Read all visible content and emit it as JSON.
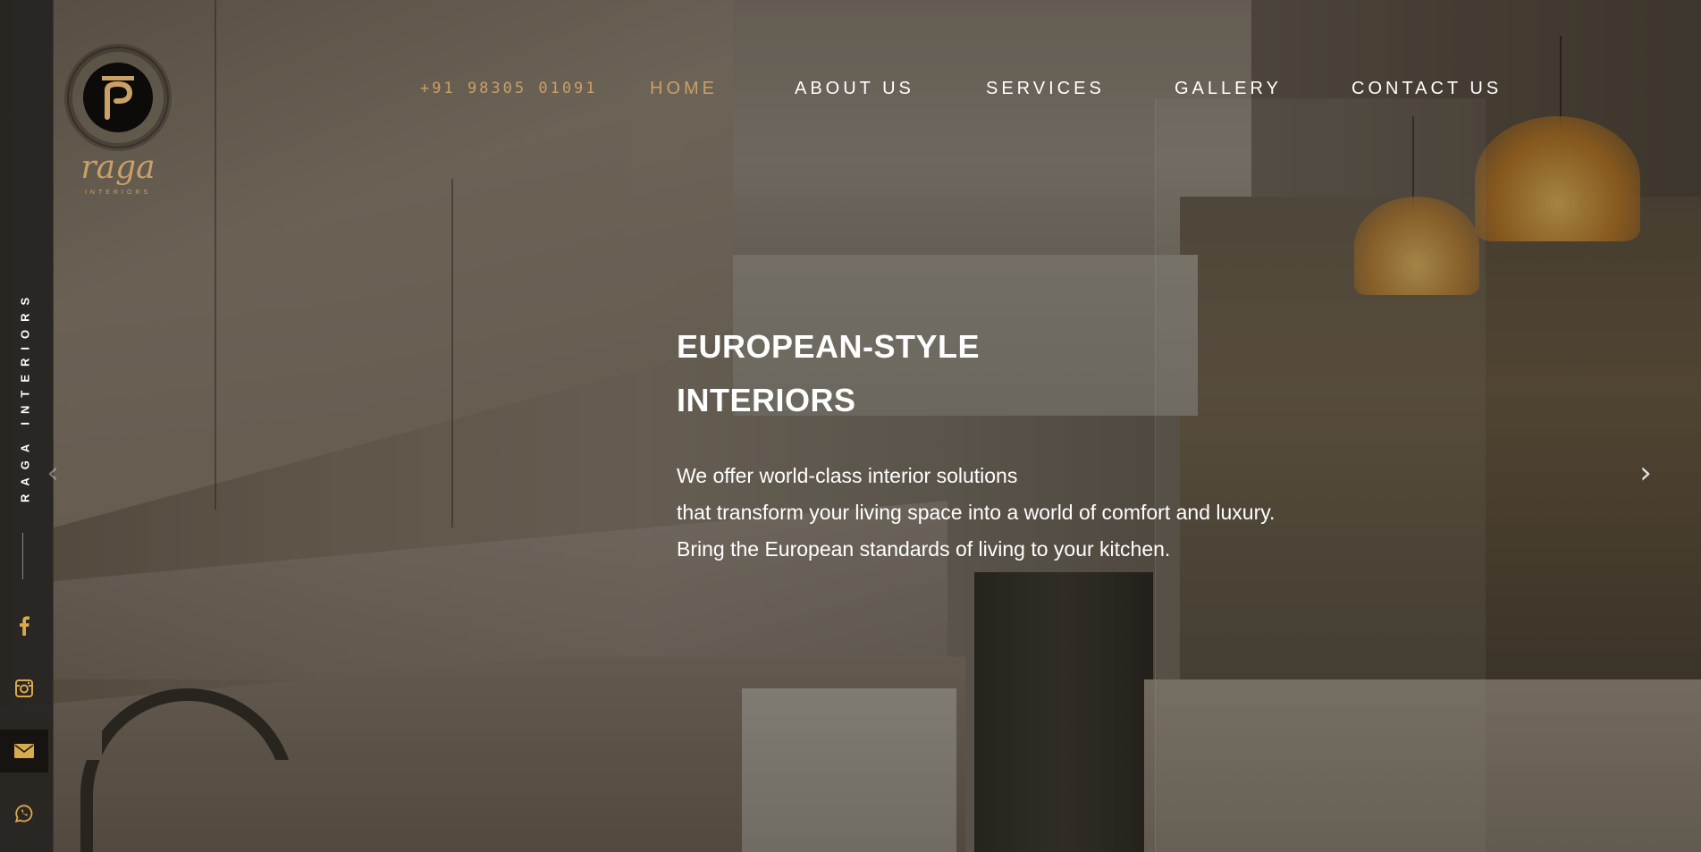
{
  "brand": {
    "logo_letter": "r",
    "logo_wordmark": "raga",
    "logo_sub": "INTERIORS",
    "vertical_text": "RAGA INTERIORS",
    "accent_color": "#c9a067"
  },
  "header": {
    "phone": "+91 98305 01091",
    "nav": [
      {
        "label": "HOME",
        "active": true
      },
      {
        "label": "ABOUT US",
        "active": false
      },
      {
        "label": "SERVICES",
        "active": false
      },
      {
        "label": "GALLERY",
        "active": false
      },
      {
        "label": "CONTACT US",
        "active": false
      }
    ]
  },
  "social": [
    {
      "icon": "facebook-icon"
    },
    {
      "icon": "instagram-icon"
    },
    {
      "icon": "mail-icon"
    },
    {
      "icon": "whatsapp-icon"
    }
  ],
  "hero": {
    "headline_line1": "EUROPEAN-STYLE",
    "headline_line2": "INTERIORS",
    "description": [
      "We offer world-class interior solutions",
      "that transform your living space into a world of comfort and luxury.",
      "Bring the European standards of living to your kitchen."
    ],
    "prev_arrow": "‹",
    "next_arrow": "›"
  }
}
